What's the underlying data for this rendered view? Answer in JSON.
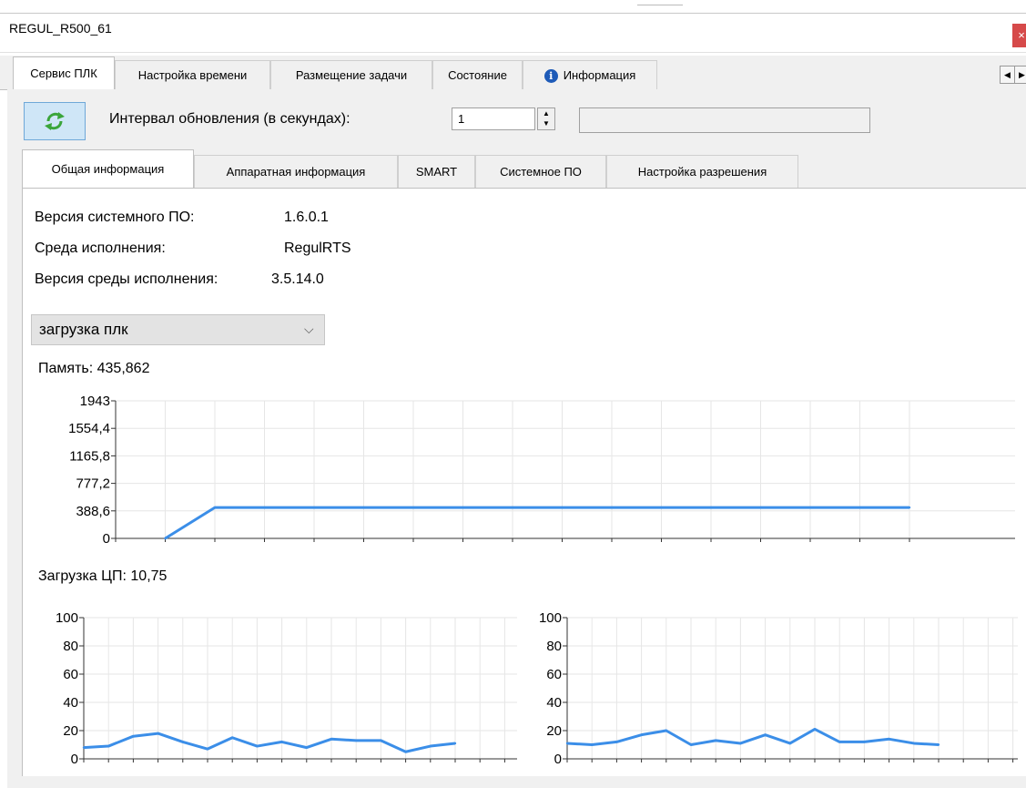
{
  "window": {
    "title": "REGUL_R500_61",
    "close_label": "×"
  },
  "main_tabs": [
    {
      "label": "Сервис ПЛК"
    },
    {
      "label": "Настройка времени"
    },
    {
      "label": "Размещение задачи"
    },
    {
      "label": "Состояние"
    },
    {
      "label": "Информация",
      "icon": "info-icon"
    }
  ],
  "toolbar": {
    "refresh_icon": "refresh-icon",
    "interval_label": "Интервал обновления (в секундах):",
    "interval_value": "1",
    "status_value": ""
  },
  "sub_tabs": [
    {
      "label": "Общая информация"
    },
    {
      "label": "Аппаратная информация"
    },
    {
      "label": "SMART"
    },
    {
      "label": "Системное ПО"
    },
    {
      "label": "Настройка разрешения"
    }
  ],
  "info": [
    {
      "label": "Версия системного ПО:",
      "value": "1.6.0.1"
    },
    {
      "label": "Среда исполнения:",
      "value": "RegulRTS"
    },
    {
      "label": "Версия среды исполнения:",
      "value": "3.5.14.0"
    }
  ],
  "combo": {
    "selected": "загрузка плк"
  },
  "memory": {
    "label": "Память:",
    "value": "435,862"
  },
  "cpu": {
    "label": "Загрузка ЦП:",
    "value": "10,75"
  },
  "colors": {
    "line": "#3b8ee8",
    "grid": "#e6e6e6",
    "panel": "#f0f0f0"
  },
  "chart_data": [
    {
      "type": "line",
      "title": "",
      "y_ticks": [
        "0",
        "388,6",
        "777,2",
        "1165,8",
        "1554,4",
        "1943"
      ],
      "ylim": [
        0,
        1943
      ],
      "x_count": 17,
      "series": [
        {
          "values": [
            null,
            0,
            436,
            436,
            436,
            436,
            436,
            436,
            436,
            436,
            436,
            436,
            436,
            436,
            436,
            436,
            436
          ]
        }
      ],
      "grid": true
    },
    {
      "type": "line",
      "title": "",
      "y_ticks": [
        "0",
        "20",
        "40",
        "60",
        "80",
        "100"
      ],
      "ylim": [
        0,
        100
      ],
      "x_count": 20,
      "series": [
        {
          "values": [
            8,
            9,
            16,
            18,
            12,
            7,
            15,
            9,
            12,
            8,
            14,
            13,
            13,
            5,
            9,
            11
          ]
        }
      ],
      "grid": true
    },
    {
      "type": "line",
      "title": "",
      "y_ticks": [
        "0",
        "20",
        "40",
        "60",
        "80",
        "100"
      ],
      "ylim": [
        0,
        100
      ],
      "x_count": 20,
      "series": [
        {
          "values": [
            11,
            10,
            12,
            17,
            20,
            10,
            13,
            11,
            17,
            11,
            21,
            12,
            12,
            14,
            11,
            10
          ]
        }
      ],
      "grid": true
    }
  ]
}
